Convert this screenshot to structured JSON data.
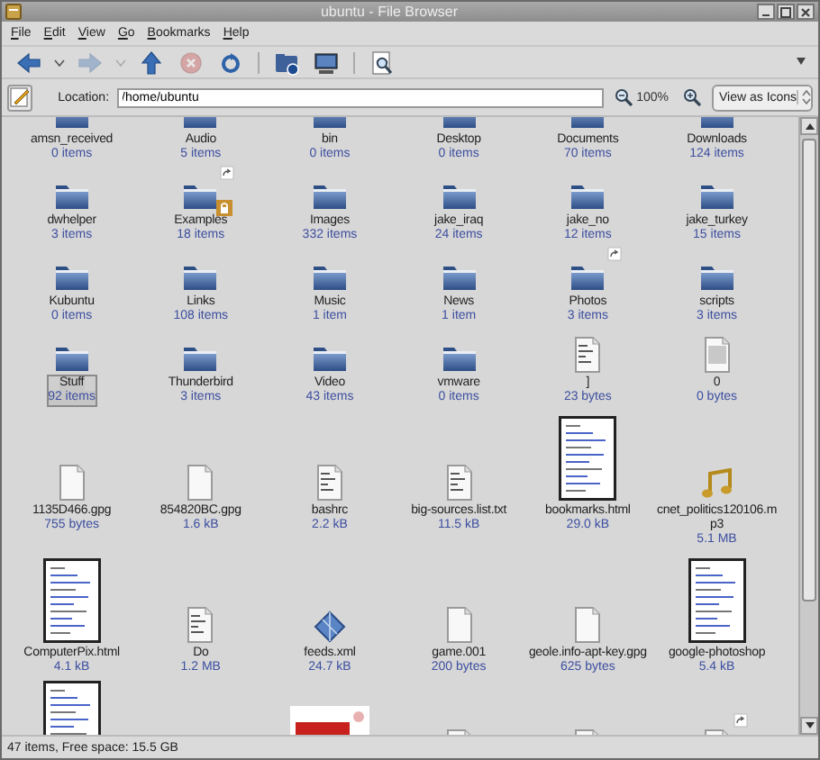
{
  "window": {
    "title": "ubuntu - File Browser"
  },
  "menu": [
    "File",
    "Edit",
    "View",
    "Go",
    "Bookmarks",
    "Help"
  ],
  "toolbar": [
    [
      {
        "kind": "back",
        "disabled": false,
        "history_menu": true
      },
      {
        "kind": "forward",
        "disabled": true,
        "history_menu": true
      },
      {
        "kind": "up",
        "disabled": false
      },
      {
        "kind": "stop",
        "disabled": true
      },
      {
        "kind": "reload",
        "disabled": false
      }
    ],
    [
      {
        "kind": "home",
        "disabled": false
      },
      {
        "kind": "computer",
        "disabled": false
      }
    ],
    [
      {
        "kind": "search",
        "disabled": false
      }
    ]
  ],
  "location_bar": {
    "label": "Location:",
    "value": "/home/ubuntu",
    "zoom": "100%",
    "view_mode": "View as Icons"
  },
  "items": [
    {
      "label": "amsn_received",
      "info": "0 items",
      "kind": "folder",
      "selected": false
    },
    {
      "label": "Audio",
      "info": "5 items",
      "kind": "folder",
      "selected": false
    },
    {
      "label": "bin",
      "info": "0 items",
      "kind": "folder",
      "selected": false
    },
    {
      "label": "Desktop",
      "info": "0 items",
      "kind": "folder",
      "selected": false
    },
    {
      "label": "Documents",
      "info": "70 items",
      "kind": "folder",
      "selected": false
    },
    {
      "label": "Downloads",
      "info": "124 items",
      "kind": "folder",
      "selected": false
    },
    {
      "label": "dwhelper",
      "info": "3 items",
      "kind": "folder",
      "selected": false
    },
    {
      "label": "Examples",
      "info": "18 items",
      "kind": "folder",
      "selected": false,
      "symlink": true,
      "locked": true
    },
    {
      "label": "Images",
      "info": "332 items",
      "kind": "folder",
      "selected": false
    },
    {
      "label": "jake_iraq",
      "info": "24 items",
      "kind": "folder",
      "selected": false
    },
    {
      "label": "jake_no",
      "info": "12 items",
      "kind": "folder",
      "selected": false
    },
    {
      "label": "jake_turkey",
      "info": "15 items",
      "kind": "folder",
      "selected": false
    },
    {
      "label": "Kubuntu",
      "info": "0 items",
      "kind": "folder",
      "selected": false
    },
    {
      "label": "Links",
      "info": "108 items",
      "kind": "folder",
      "selected": false
    },
    {
      "label": "Music",
      "info": "1 item",
      "kind": "folder",
      "selected": false
    },
    {
      "label": "News",
      "info": "1 item",
      "kind": "folder",
      "selected": false
    },
    {
      "label": "Photos",
      "info": "3 items",
      "kind": "folder",
      "selected": false,
      "symlink": true
    },
    {
      "label": "scripts",
      "info": "3 items",
      "kind": "folder",
      "selected": false
    },
    {
      "label": "Stuff",
      "info": "92 items",
      "kind": "folder",
      "selected": true
    },
    {
      "label": "Thunderbird",
      "info": "3 items",
      "kind": "folder",
      "selected": false
    },
    {
      "label": "Video",
      "info": "43 items",
      "kind": "folder",
      "selected": false
    },
    {
      "label": "vmware",
      "info": "0 items",
      "kind": "folder",
      "selected": false
    },
    {
      "label": "]",
      "info": "23 bytes",
      "kind": "text",
      "selected": false
    },
    {
      "label": "0",
      "info": "0 bytes",
      "kind": "generic",
      "selected": false
    },
    {
      "label": "1135D466.gpg",
      "info": "755 bytes",
      "kind": "document",
      "selected": false
    },
    {
      "label": "854820BC.gpg",
      "info": "1.6 kB",
      "kind": "document",
      "selected": false
    },
    {
      "label": "bashrc",
      "info": "2.2 kB",
      "kind": "text",
      "selected": false
    },
    {
      "label": "big-sources.list.txt",
      "info": "11.5 kB",
      "kind": "text",
      "selected": false
    },
    {
      "label": "bookmarks.html",
      "info": "29.0 kB",
      "kind": "page",
      "selected": false
    },
    {
      "label": "cnet_politics120106.mp3",
      "info": "5.1 MB",
      "kind": "audio",
      "selected": false
    },
    {
      "label": "ComputerPix.html",
      "info": "4.1 kB",
      "kind": "page",
      "selected": false
    },
    {
      "label": "Do",
      "info": "1.2 MB",
      "kind": "text",
      "selected": false
    },
    {
      "label": "feeds.xml",
      "info": "24.7 kB",
      "kind": "xml",
      "selected": false
    },
    {
      "label": "game.001",
      "info": "200 bytes",
      "kind": "document",
      "selected": false
    },
    {
      "label": "geole.info-apt-key.gpg",
      "info": "625 bytes",
      "kind": "document",
      "selected": false
    },
    {
      "label": "google-photoshop",
      "info": "5.4 kB",
      "kind": "page",
      "selected": false
    },
    {
      "kind": "page"
    },
    {
      "kind": "hidden"
    },
    {
      "kind": "picture"
    },
    {
      "kind": "document"
    },
    {
      "kind": "document"
    },
    {
      "kind": "document",
      "symlink": true
    }
  ],
  "status_bar": "47 items, Free space: 15.5 GB"
}
